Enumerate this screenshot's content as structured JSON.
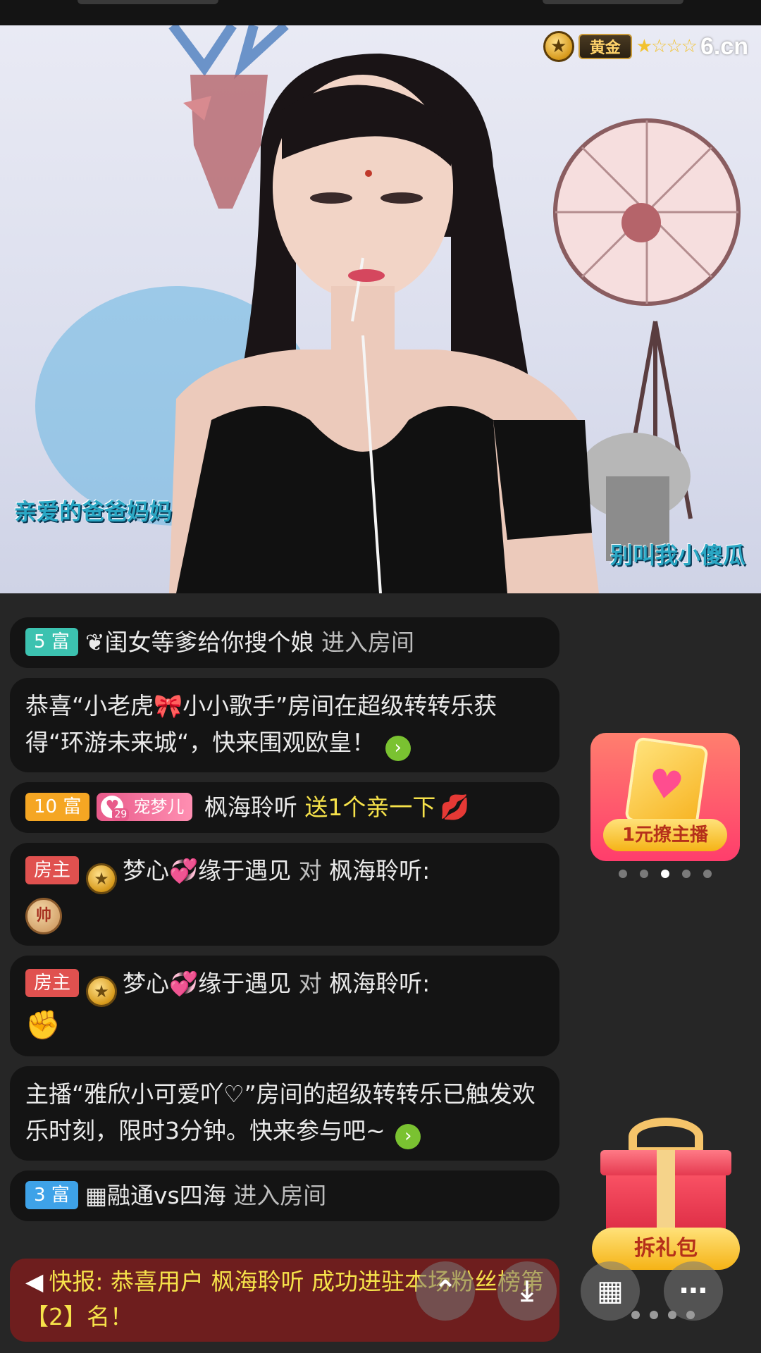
{
  "stream": {
    "level_label": "黄金",
    "stars": "★☆☆☆",
    "logo": "6.cn",
    "caption_left": "亲爱的爸爸妈妈",
    "caption_right": "别叫我小傻瓜"
  },
  "chat": [
    {
      "badge": "5 富",
      "icon": "❦",
      "user": "闺女等爹给你搜个娘",
      "action": "进入房间"
    },
    {
      "text": "恭喜“小老虎🎀小小歌手”房间在超级转转乐获得“环游未来城“，快来围观欧皇！",
      "go": "›"
    },
    {
      "badge": "10 富",
      "pet_name": "宠梦儿",
      "pet_level": "29",
      "user": "枫海聆听",
      "action": "送1个亲一下"
    },
    {
      "badge": "房主",
      "user": "梦心💞缘于遇见",
      "to": "对",
      "target": "枫海聆听:",
      "chip": "帅"
    },
    {
      "badge": "房主",
      "user": "梦心💞缘于遇见",
      "to": "对",
      "target": "枫海聆听:",
      "emoji": "✊"
    },
    {
      "text": "主播“雅欣小可爱吖♡”房间的超级转转乐已触发欢乐时刻，限时3分钟。快来参与吧~",
      "go": "›"
    },
    {
      "badge": "3 富",
      "icon": "▦",
      "user": "融通vs四海",
      "action": "进入房间"
    }
  ],
  "announce": {
    "icon": "◀",
    "text": "快报: 恭喜用户 枫海聆听 成功进驻本场粉丝榜第【2】名！"
  },
  "promo": {
    "label": "1元撩主播",
    "active_slide": 3,
    "slide_count": 5
  },
  "gift_pack": {
    "label": "拆礼包"
  },
  "fabs": {
    "share": "⌃",
    "download": "⤓",
    "grid": "▦",
    "more": "⋯"
  },
  "colors": {
    "background": "#262626",
    "bubble": "#141414",
    "highlight": "#f6e24a",
    "announce_bg": "#6e1e1e"
  }
}
